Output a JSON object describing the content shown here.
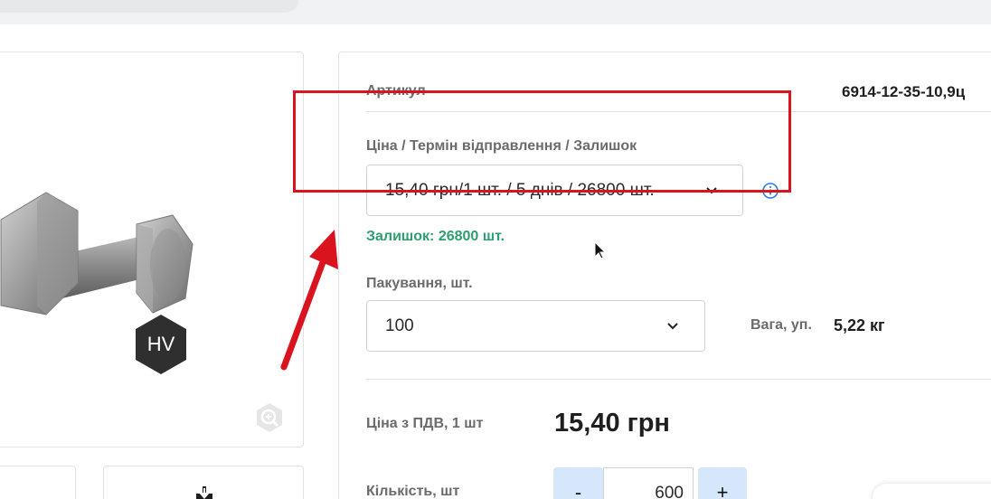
{
  "product": {
    "badge": "HV",
    "article_label": "Артикул",
    "article_value": "6914-12-35-10,9ц"
  },
  "price_term": {
    "label": "Ціна / Термін відправлення / Залишок",
    "selected": "15,40 грн/1 шт. / 5 днів / 26800 шт.",
    "stock_text": "Залишок: 26800 шт."
  },
  "packaging": {
    "label": "Пакування, шт.",
    "selected": "100",
    "weight_label": "Вага, уп.",
    "weight_value": "5,22 кг"
  },
  "price_vat": {
    "label": "Ціна з ПДВ, 1 шт",
    "value": "15,40 грн"
  },
  "quantity": {
    "label": "Кількість, шт",
    "value": "600",
    "minus": "-",
    "plus": "+"
  },
  "icons": {
    "zoom": "zoom-icon",
    "info": "info-icon",
    "chevron": "chevron-down-icon",
    "download": "download-icon"
  },
  "colors": {
    "stock_green": "#2c9e6f",
    "annotation_red": "#d9141f",
    "stepper_blue": "#d6e6fb",
    "info_blue": "#2a7de1"
  }
}
